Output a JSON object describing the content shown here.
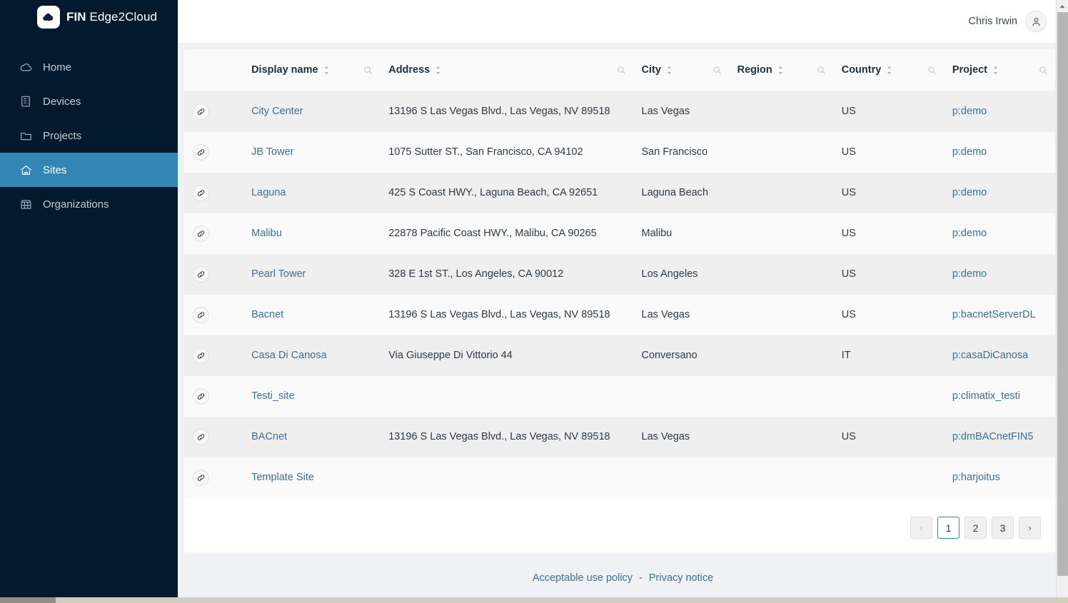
{
  "brand": {
    "logo_icon": "cloud-arrow-logo-icon",
    "name_bold": "FIN",
    "name_rest": " Edge2Cloud"
  },
  "sidebar": {
    "items": [
      {
        "label": "Home",
        "icon": "cloud-icon",
        "active": false
      },
      {
        "label": "Devices",
        "icon": "server-icon",
        "active": false
      },
      {
        "label": "Projects",
        "icon": "folder-icon",
        "active": false
      },
      {
        "label": "Sites",
        "icon": "house-icon",
        "active": true
      },
      {
        "label": "Organizations",
        "icon": "building-icon",
        "active": false
      }
    ]
  },
  "topbar": {
    "user_name": "Chris Irwin",
    "avatar_icon": "user-avatar-icon"
  },
  "table": {
    "columns": [
      {
        "key": "link",
        "label": "",
        "sortable": false,
        "searchable": false
      },
      {
        "key": "name",
        "label": "Display name",
        "sortable": true,
        "searchable": true
      },
      {
        "key": "address",
        "label": "Address",
        "sortable": true,
        "searchable": true
      },
      {
        "key": "city",
        "label": "City",
        "sortable": true,
        "searchable": true
      },
      {
        "key": "region",
        "label": "Region",
        "sortable": true,
        "searchable": true
      },
      {
        "key": "country",
        "label": "Country",
        "sortable": true,
        "searchable": true
      },
      {
        "key": "project",
        "label": "Project",
        "sortable": true,
        "searchable": true
      }
    ],
    "row_link_icon": "chain-link-icon",
    "rows": [
      {
        "name": "City Center",
        "address": "13196 S Las Vegas Blvd., Las Vegas, NV 89518",
        "city": "Las Vegas",
        "region": "",
        "country": "US",
        "project": "p:demo"
      },
      {
        "name": "JB Tower",
        "address": "1075 Sutter ST., San Francisco, CA 94102",
        "city": "San Francisco",
        "region": "",
        "country": "US",
        "project": "p:demo"
      },
      {
        "name": "Laguna",
        "address": "425 S Coast HWY., Laguna Beach, CA 92651",
        "city": "Laguna Beach",
        "region": "",
        "country": "US",
        "project": "p:demo"
      },
      {
        "name": "Malibu",
        "address": "22878 Pacific Coast HWY., Malibu, CA 90265",
        "city": "Malibu",
        "region": "",
        "country": "US",
        "project": "p:demo"
      },
      {
        "name": "Pearl Tower",
        "address": "328 E 1st ST., Los Angeles, CA 90012",
        "city": "Los Angeles",
        "region": "",
        "country": "US",
        "project": "p:demo"
      },
      {
        "name": "Bacnet",
        "address": "13196 S Las Vegas Blvd., Las Vegas, NV 89518",
        "city": "Las Vegas",
        "region": "",
        "country": "US",
        "project": "p:bacnetServerDL"
      },
      {
        "name": "Casa Di Canosa",
        "address": "Via Giuseppe Di Vittorio 44",
        "city": "Conversano",
        "region": "",
        "country": "IT",
        "project": "p:casaDiCanosa"
      },
      {
        "name": "Testi_site",
        "address": "",
        "city": "",
        "region": "",
        "country": "",
        "project": "p:climatix_testi"
      },
      {
        "name": "BACnet",
        "address": "13196 S Las Vegas Blvd., Las Vegas, NV 89518",
        "city": "Las Vegas",
        "region": "",
        "country": "US",
        "project": "p:dmBACnetFIN5"
      },
      {
        "name": "Template Site",
        "address": "",
        "city": "",
        "region": "",
        "country": "",
        "project": "p:harjoitus"
      }
    ]
  },
  "pagination": {
    "prev_label": "‹",
    "next_label": "›",
    "pages": [
      "1",
      "2",
      "3"
    ],
    "current_page": "1",
    "prev_disabled": true
  },
  "footer": {
    "acceptable_use": "Acceptable use policy",
    "separator": "-",
    "privacy": "Privacy notice"
  },
  "colors": {
    "sidebar_bg": "#031a2e",
    "accent": "#3186b4",
    "link": "#3d6e99",
    "page_bg": "#eff1f5",
    "row_even": "#efefef",
    "row_odd": "#fafafa"
  }
}
